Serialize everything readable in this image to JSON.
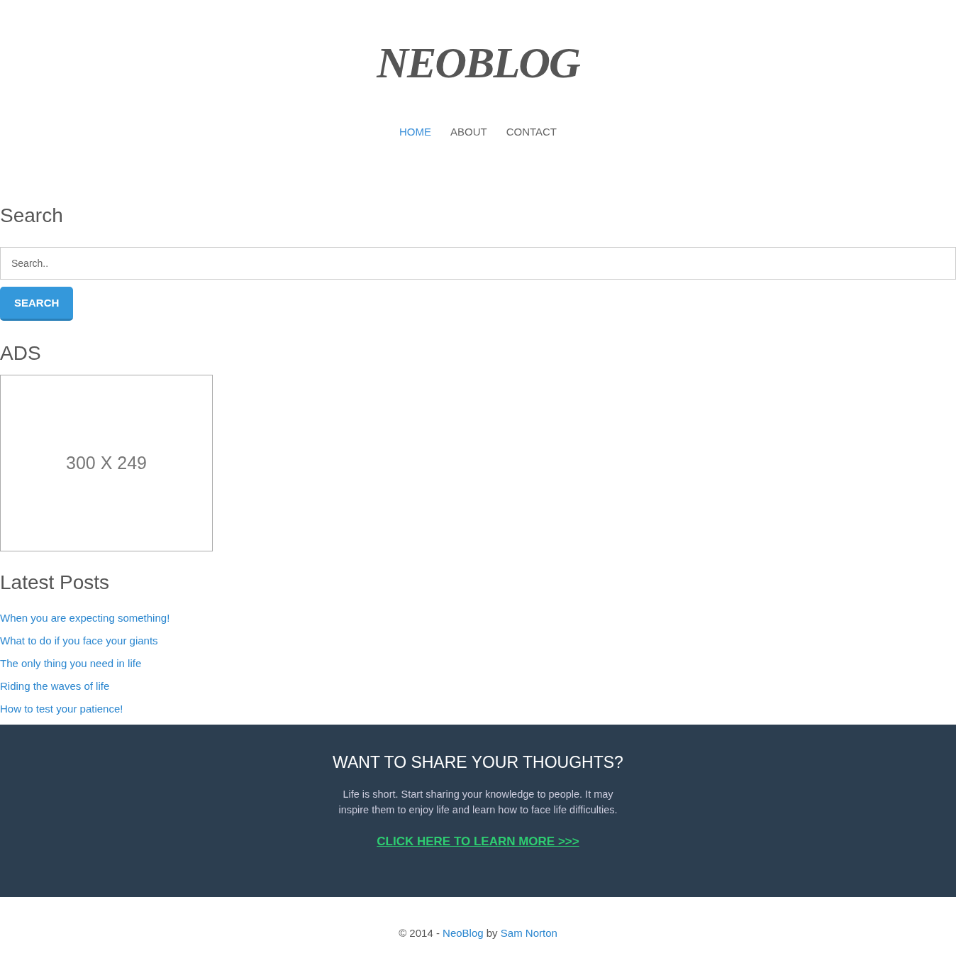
{
  "logo": "NEOBLOG",
  "nav": [
    {
      "label": "HOME",
      "selected": true
    },
    {
      "label": "ABOUT",
      "selected": false
    },
    {
      "label": "CONTACT",
      "selected": false
    }
  ],
  "search": {
    "title": "Search",
    "placeholder": "Search..",
    "button": "SEARCH"
  },
  "ads": {
    "title": "ADS",
    "placeholder_text": "300 X 249"
  },
  "latest_posts": {
    "title": "Latest Posts",
    "items": [
      "When you are expecting something!",
      "What to do if you face your giants",
      "The only thing you need in life",
      "Riding the waves of life",
      "How to test your patience!"
    ]
  },
  "cta": {
    "title": "WANT TO SHARE YOUR THOUGHTS?",
    "text": "Life is short. Start sharing your knowledge to people. It may inspire them to enjoy life and learn how to face life difficulties.",
    "link": "CLICK HERE TO LEARN MORE >>>"
  },
  "footer": {
    "prefix": "© 2014 -",
    "site_link": "NeoBlog",
    "by": "by",
    "author_link": "Sam Norton"
  }
}
